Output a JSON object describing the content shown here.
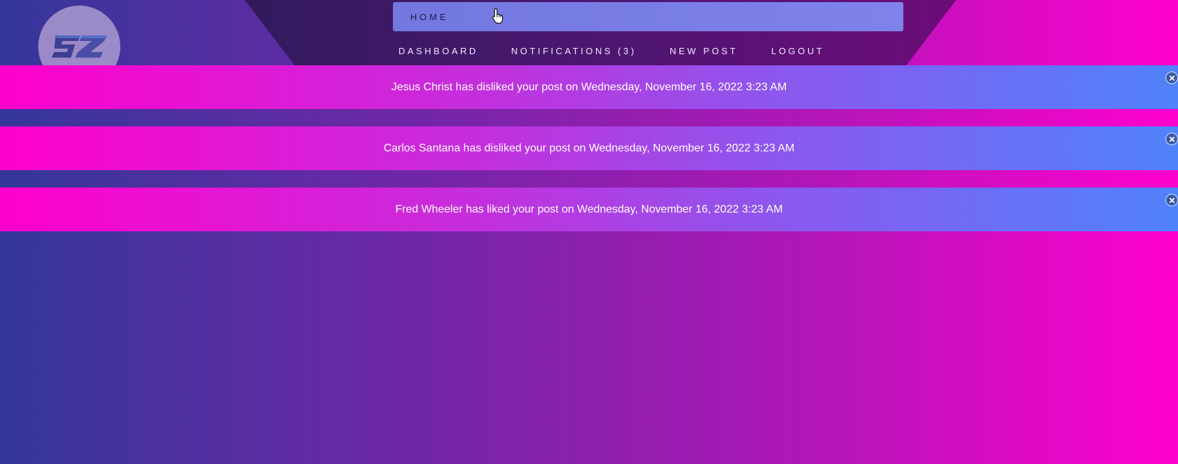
{
  "logo": {
    "icon": "sz-logo-icon",
    "text": "SZ"
  },
  "nav": {
    "home_label": "HOME",
    "links": [
      {
        "label": "DASHBOARD"
      },
      {
        "label": "NOTIFICATIONS (3)"
      },
      {
        "label": "NEW POST"
      },
      {
        "label": "LOGOUT"
      }
    ]
  },
  "notifications": [
    {
      "text": "Jesus Christ has disliked your post on Wednesday, November 16, 2022 3:23 AM",
      "close_icon": "close-icon"
    },
    {
      "text": "Carlos Santana has disliked your post on Wednesday, November 16, 2022 3:23 AM",
      "close_icon": "close-icon"
    },
    {
      "text": "Fred Wheeler has liked your post on Wednesday, November 16, 2022 3:23 AM",
      "close_icon": "close-icon"
    }
  ],
  "colors": {
    "background_start": "#34379a",
    "background_end": "#ff00cf",
    "notification_start": "#ff00cc",
    "notification_end": "#4f83fb",
    "home_bar": "#7b7fe6"
  }
}
